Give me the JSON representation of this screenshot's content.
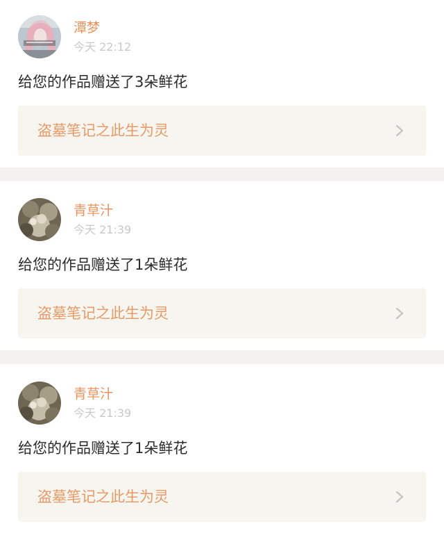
{
  "colors": {
    "username": "#e8935b",
    "timestamp": "#c9c9c9",
    "message": "#2b2b2b",
    "link_text": "#e89a66",
    "link_bg": "#f6f5f0",
    "divider": "#f3f2f0"
  },
  "notifications": [
    {
      "username": "潭梦",
      "time": "今天 22:12",
      "message": "给您的作品赠送了3朵鲜花",
      "work_title": "盗墓笔记之此生为灵",
      "avatar_icon": "pink-hair-portrait-avatar",
      "link_icon": "chevron-right-icon"
    },
    {
      "username": "青草汁",
      "time": "今天 21:39",
      "message": "给您的作品赠送了1朵鲜花",
      "work_title": "盗墓笔记之此生为灵",
      "avatar_icon": "plant-photo-avatar",
      "link_icon": "chevron-right-icon"
    },
    {
      "username": "青草汁",
      "time": "今天 21:39",
      "message": "给您的作品赠送了1朵鲜花",
      "work_title": "盗墓笔记之此生为灵",
      "avatar_icon": "plant-photo-avatar",
      "link_icon": "chevron-right-icon"
    }
  ]
}
